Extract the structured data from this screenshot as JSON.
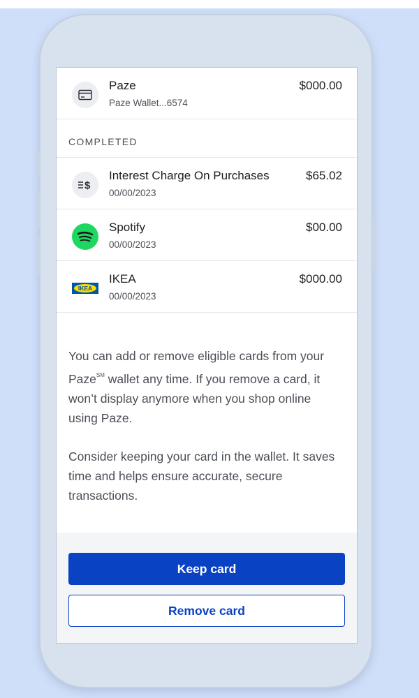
{
  "pending_items": [
    {
      "name": "Paze",
      "sub": "Paze Wallet...6574",
      "amount": "$000.00",
      "icon": "card-icon"
    }
  ],
  "completed_section": {
    "heading": "COMPLETED",
    "items": [
      {
        "name": "Interest Charge On Purchases",
        "date": "00/00/2023",
        "amount": "$65.02",
        "icon": "interest-charge-icon"
      },
      {
        "name": "Spotify",
        "date": "00/00/2023",
        "amount": "$00.00",
        "icon": "spotify-logo-icon"
      },
      {
        "name": "IKEA",
        "date": "00/00/2023",
        "amount": "$000.00",
        "icon": "ikea-logo-icon",
        "logo_text": "IKEA"
      }
    ]
  },
  "info": {
    "p1_start": "You can add or remove eligible cards from your Paze",
    "p1_mark": "SM",
    "p1_end": " wallet any time. If you remove a card, it won’t display anymore when you shop online using Paze.",
    "p2": "Consider keeping your card in the wallet. It saves time and helps ensure accurate, secure transactions."
  },
  "actions": {
    "keep_label": "Keep card",
    "remove_label": "Remove card"
  },
  "colors": {
    "primary": "#0a42c4",
    "spotify": "#1ed760",
    "ikea_blue": "#0058a3",
    "ikea_yellow": "#ffdb00"
  }
}
